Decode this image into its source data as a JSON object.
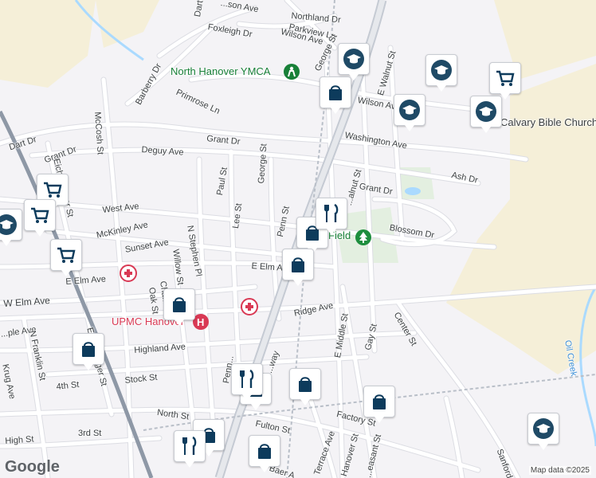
{
  "map": {
    "attribution": "Map data ©2025",
    "logo": "Google"
  },
  "streets": {
    "northland_dr": "Northland Dr",
    "parkview_ln": "Parkview Ln",
    "wilson_ave_n": "Wilson Ave",
    "george_st_n": "George St",
    "foxleigh_dr": "Foxleigh Dr",
    "dart_top": "Dart Dr",
    "madison_ave": "...son Ave",
    "barberry_dr": "Barberry Dr",
    "primrose_ln": "Primrose Ln",
    "mccosh_st": "McCosh St",
    "dart_dr": "Dart Dr",
    "grant_dr_w": "Grant Dr",
    "grant_dr_c": "Grant Dr",
    "grant_dr_e": "Grant Dr",
    "deguy_ave": "Deguy Ave",
    "eichelberger_st_n": "Eichelberger St",
    "george_st_c": "George St",
    "paul_st": "Paul St",
    "washington_ave": "Washington Ave",
    "e_walnut_st_n": "E Walnut St",
    "wilson_ave_e": "Wilson Ave",
    "ash_dr": "Ash Dr",
    "west_ave": "West Ave",
    "mckinley_ave": "McKinley Ave",
    "sunset_ave": "Sunset Ave",
    "n_stephen_pl": "N Stephen Pl",
    "lee_st": "Lee St",
    "penn_st": "Penn St",
    "walnut_st_s": "...alnut St",
    "blossom_dr": "Blossom Dr",
    "e_elm_ave_c": "E Elm Ave",
    "e_elm_ave_w": "E Elm Ave",
    "w_elm_ave": "W Elm Ave",
    "willow_st": "Willow St",
    "charles_st": "Cha...",
    "oak_st": "Oak St",
    "ridge_ave": "Ridge Ave",
    "e_middle_st": "E Middle St",
    "gay_st": "Gay St",
    "center_st": "Center St",
    "maple_ave": "...ple Ave",
    "n_franklin_st": "N Franklin St",
    "highland_ave": "Highland Ave",
    "krug_ave": "Krug Ave",
    "eichelberger_st_s": "Eichelberger St",
    "fourth_st": "4th St",
    "stock_st": "Stock St",
    "penn_st_s": "Penn...",
    "broadway": "...way",
    "north_st": "North St",
    "third_st": "3rd St",
    "fulton_st": "Fulton St",
    "factory_st": "Factory St",
    "high_st": "High St",
    "terrace_ave": "Terrace Ave",
    "hanover_st": "Hanover St",
    "pleasant_st": "...easant St",
    "baer_ave": "Baer A...",
    "sanford": "Sanford...",
    "oil_creek": "Oil Creek",
    "field": "Field"
  },
  "places": {
    "ymca": "North Hanover YMCA",
    "upmc": "UPMC Hanover",
    "calvary": "Calvary Bible Church"
  },
  "colors": {
    "land": "#f4f3f6",
    "road": "#ffffff",
    "road_outline": "#dcdde3",
    "highway": "#c5cad3",
    "rail": "#8e98a6",
    "park": "#dfeedd",
    "field": "#f5efd8",
    "water": "#aadaff",
    "shopping_pin": "#0d3b5c",
    "school_pin": "#1f4a66",
    "hospital": "#d93954",
    "park_green": "#1e8e3e",
    "poi_green": "#188038"
  }
}
